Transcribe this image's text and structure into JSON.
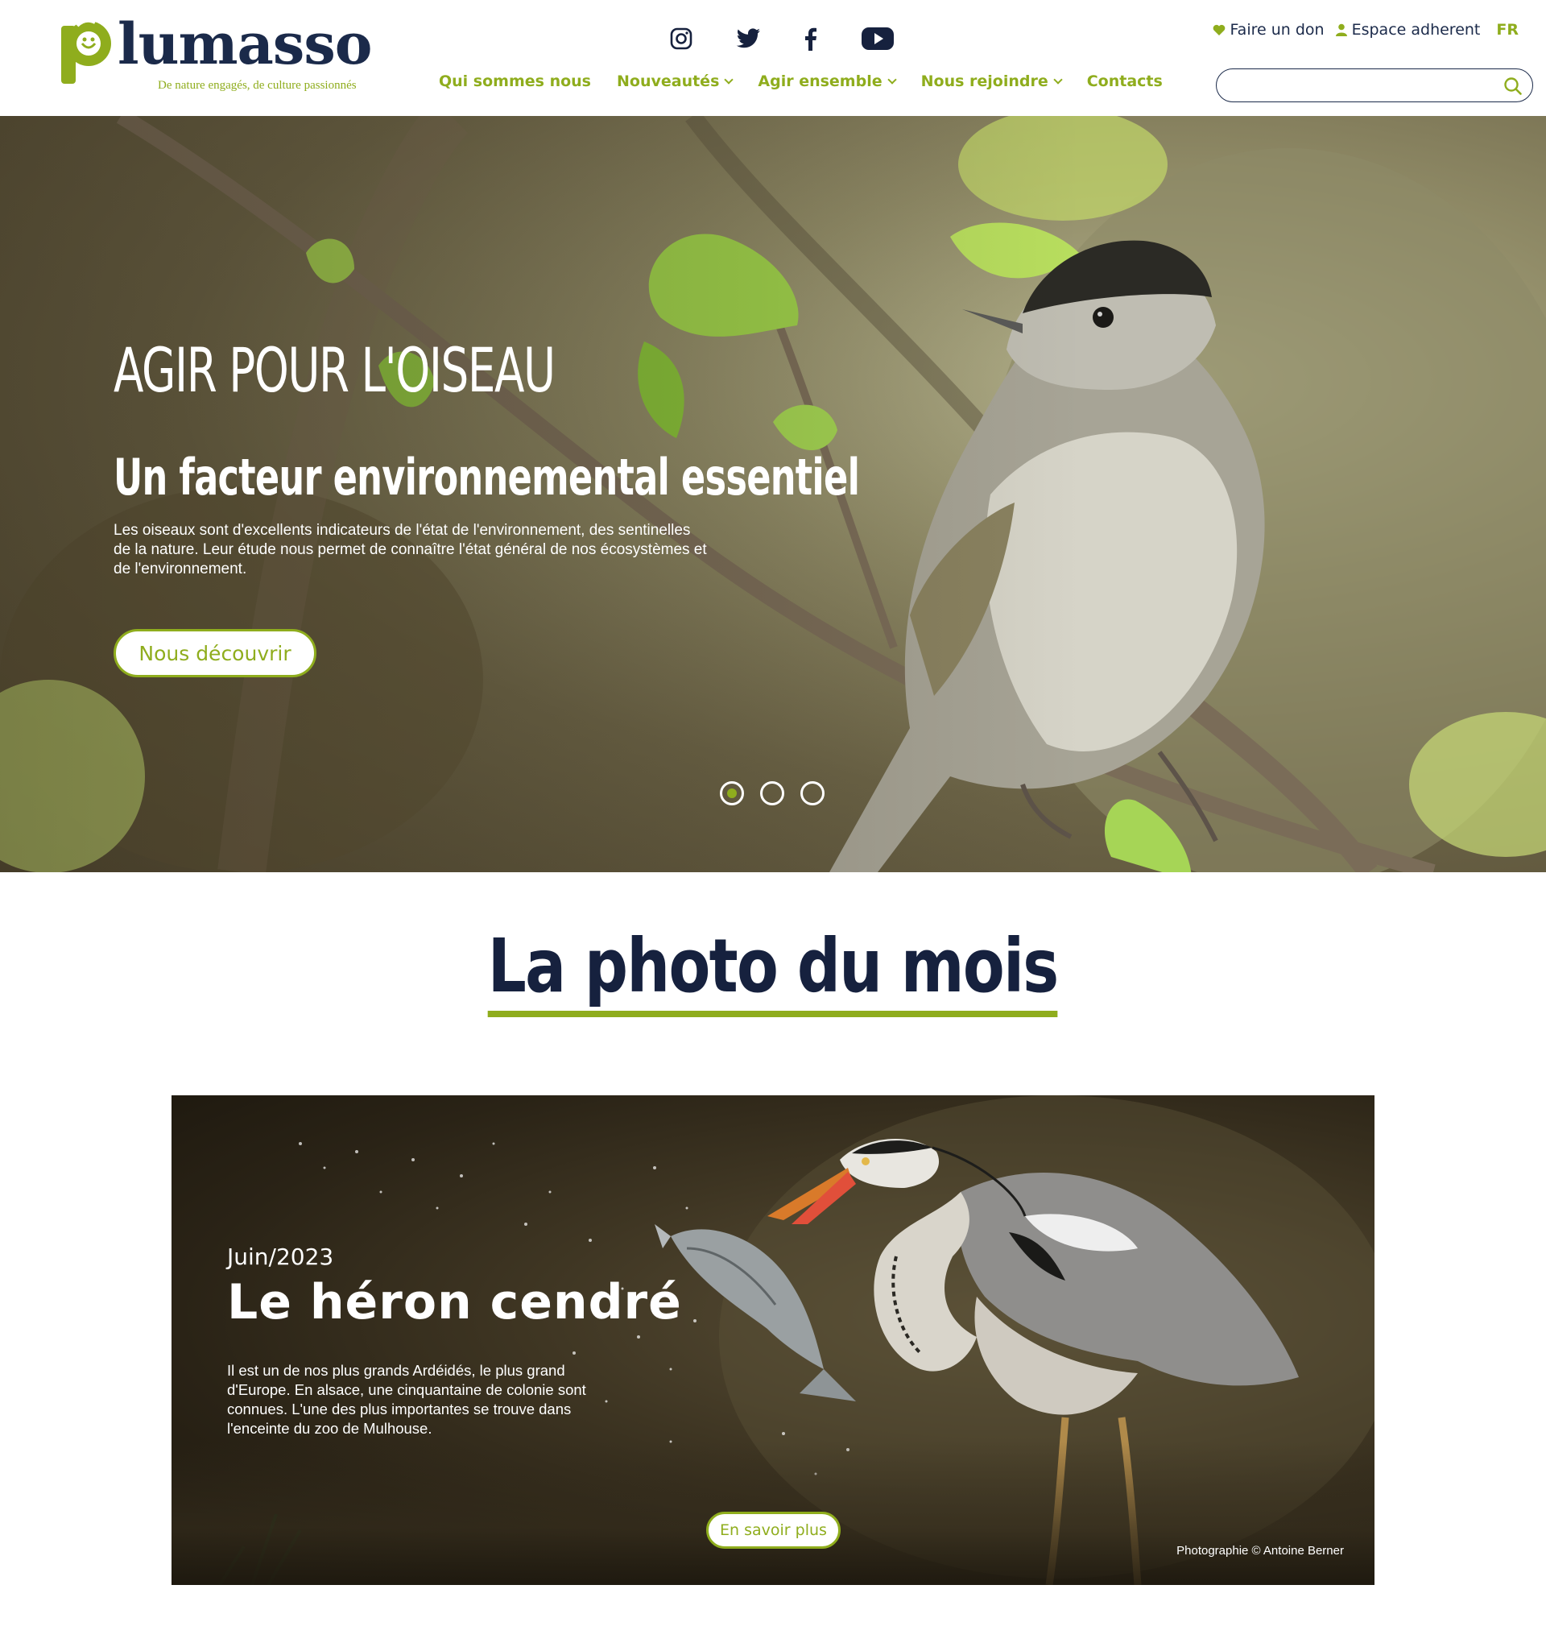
{
  "logo": {
    "word": "lumasso",
    "tagline": "De nature engagés, de culture passionnés"
  },
  "social": {
    "icons": [
      "instagram-icon",
      "twitter-icon",
      "facebook-icon",
      "youtube-icon"
    ]
  },
  "nav": {
    "items": [
      {
        "label": "Qui sommes nous",
        "dropdown": false
      },
      {
        "label": "Nouveautés",
        "dropdown": true
      },
      {
        "label": "Agir ensemble",
        "dropdown": true
      },
      {
        "label": "Nous rejoindre",
        "dropdown": true
      },
      {
        "label": "Contacts",
        "dropdown": false
      }
    ]
  },
  "top_links": {
    "donate": "Faire un don",
    "member": "Espace adherent",
    "lang": "FR"
  },
  "search": {
    "placeholder": "",
    "value": ""
  },
  "hero": {
    "title": "AGIR POUR L'OISEAU",
    "subtitle": "Un facteur environnemental essentiel",
    "text": "Les oiseaux sont d'excellents indicateurs de l'état de l'environnement, des sentinelles de la nature. Leur étude nous permet de connaître l'état général de nos écosystèmes et de l'environnement.",
    "button": "Nous découvrir",
    "slides_total": 3,
    "active_slide": 1
  },
  "photo_du_mois": {
    "heading": "La photo du mois",
    "date": "Juin/2023",
    "title": "Le héron cendré",
    "text": "Il est un de nos plus grands Ardéidés, le plus grand d'Europe. En alsace, une cinquantaine de colonie sont connues. L'une des plus importantes se trouve dans l'enceinte du zoo de Mulhouse.",
    "button": "En savoir plus",
    "credit": "Photographie © Antoine Berner"
  },
  "colors": {
    "accent": "#8fad1d",
    "navy": "#16213e"
  }
}
